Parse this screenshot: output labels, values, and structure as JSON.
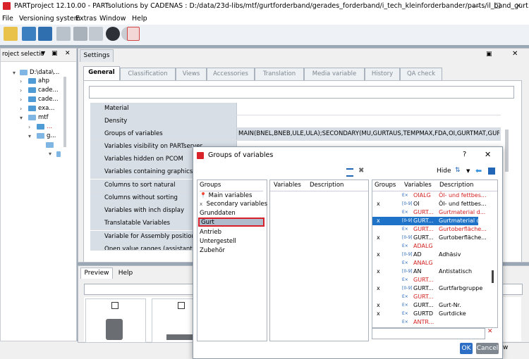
{
  "title": "PARTproject 12.10.00 - PARTsolutions by CADENAS : D:/data/23d-libs/mtf/gurtforderband/gerades_forderband/i_tech_kleinforderbander/parts/il_band_gurt.prj",
  "menu": [
    "File",
    "Versioning system",
    "Extras",
    "Window",
    "Help"
  ],
  "left_panel": {
    "title": "roject selectio",
    "tree": [
      "D:\\data\\...",
      "ahp",
      "cade...",
      "cade...",
      "exa...",
      "mtf",
      "...",
      "g...",
      "..."
    ]
  },
  "settings": {
    "tab_title": "Settings",
    "tabs": [
      "General",
      "Classification",
      "Views",
      "Accessories",
      "Translation",
      "Media variable",
      "History",
      "QA check"
    ],
    "rows": [
      {
        "key": "Material",
        "value": ""
      },
      {
        "key": "Density",
        "value": ""
      },
      {
        "key": "Groups of variables",
        "value": "MAIN(BNEL,BNEB,ULE,ULA);SECONDARY(MU,GURTAUS,TEMPMAX,FDA,OI,GURTMAT,GURTOB..."
      },
      {
        "key": "Variables visibility on PARTserver",
        "value": ""
      },
      {
        "key": "Variables hidden on PCOM",
        "value": ""
      },
      {
        "key": "Variables containing graphics",
        "value": ""
      },
      {
        "key": "Columns to sort natural",
        "value": ""
      },
      {
        "key": "Columns without sorting",
        "value": ""
      },
      {
        "key": "Variables with inch display",
        "value": ""
      },
      {
        "key": "Translatable Variables",
        "value": ""
      },
      {
        "key": "Variable for Assembly positionin",
        "value": ""
      },
      {
        "key": "Open value ranges (assistant)",
        "value": ""
      }
    ]
  },
  "preview": {
    "tabs": [
      "Preview",
      "Help"
    ]
  },
  "dialog": {
    "title": "Groups of variables",
    "help": "?",
    "close": "✕",
    "hide_label": "Hide",
    "groups_header": "Groups",
    "groups": [
      {
        "label": "Main variables",
        "icon": "pin"
      },
      {
        "label": "Secondary variables",
        "icon": "x"
      },
      {
        "label": "Grunddaten",
        "icon": ""
      },
      {
        "label": "Gurt",
        "icon": "",
        "selected": true
      },
      {
        "label": "Antrieb",
        "icon": ""
      },
      {
        "label": "Untergestell",
        "icon": ""
      },
      {
        "label": "Zubehör",
        "icon": ""
      }
    ],
    "mid_headers": [
      "Variables",
      "Description"
    ],
    "right_headers": [
      "Groups",
      "Variables",
      "Description"
    ],
    "variables": [
      {
        "g": "",
        "t": "E×",
        "v": "OIALG",
        "d": "Öl- und fettbes...",
        "red": true
      },
      {
        "g": "x",
        "t": "[0-9]",
        "v": "OI",
        "d": "Öl- und fettbes...",
        "red": false
      },
      {
        "g": "",
        "t": "E×",
        "v": "GURT...",
        "d": "Gurtmaterial d...",
        "red": true
      },
      {
        "g": "x",
        "t": "[0-9]",
        "v": "GURT...",
        "d": "Gurtmaterial d...",
        "red": false,
        "selected": true
      },
      {
        "g": "",
        "t": "E×",
        "v": "GURT...",
        "d": "Gurtoberfläche...",
        "red": true
      },
      {
        "g": "x",
        "t": "[0-9]",
        "v": "GURT...",
        "d": "Gurtoberfläche...",
        "red": false
      },
      {
        "g": "",
        "t": "E×",
        "v": "ADALG",
        "d": "",
        "red": true
      },
      {
        "g": "x",
        "t": "[0-9]",
        "v": "AD",
        "d": "Adhäsiv",
        "red": false
      },
      {
        "g": "",
        "t": "E×",
        "v": "ANALG",
        "d": "",
        "red": true
      },
      {
        "g": "x",
        "t": "[0-9]",
        "v": "AN",
        "d": "Antistatisch",
        "red": false
      },
      {
        "g": "",
        "t": "E×",
        "v": "GURT...",
        "d": "",
        "red": true
      },
      {
        "g": "x",
        "t": "[0-9]",
        "v": "GURT...",
        "d": "Gurtfarbgruppe",
        "red": false
      },
      {
        "g": "",
        "t": "E×",
        "v": "GURT...",
        "d": "",
        "red": true
      },
      {
        "g": "x",
        "t": "E×",
        "v": "GURT...",
        "d": "Gurt-Nr.",
        "red": false
      },
      {
        "g": "x",
        "t": "E×",
        "v": "GURTD",
        "d": "Gurtdicke",
        "red": false
      },
      {
        "g": "",
        "t": "E×",
        "v": "ANTR...",
        "d": "",
        "red": true
      }
    ],
    "ok": "OK",
    "cancel": "Cancel"
  },
  "status_right": "w"
}
